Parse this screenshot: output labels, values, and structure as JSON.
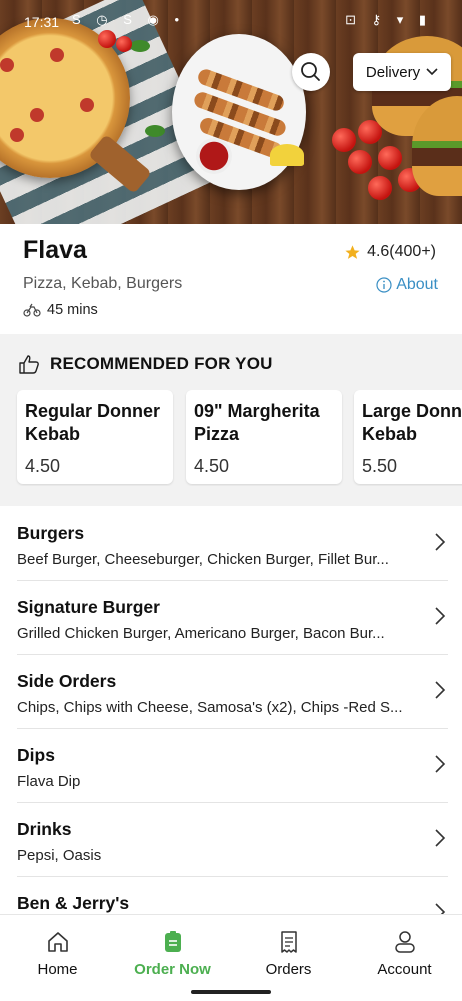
{
  "status_bar": {
    "time": "17:31",
    "left_icons": "S ◷ S ◉ •",
    "right_icons": "⊡ ⚷ ▾ ▮"
  },
  "header": {
    "delivery_label": "Delivery"
  },
  "restaurant": {
    "name": "Flava",
    "cuisines": "Pizza, Kebab, Burgers",
    "eta": "45 mins",
    "rating": "4.6(400+)",
    "about_label": "About"
  },
  "recommended": {
    "title": "RECOMMENDED FOR YOU",
    "items": [
      {
        "name": "Regular Donner\nKebab",
        "price": "4.50"
      },
      {
        "name": "09\" Margherita\nPizza",
        "price": "4.50"
      },
      {
        "name": "Large Donn\nKebab",
        "price": "5.50"
      }
    ]
  },
  "categories": [
    {
      "name": "Burgers",
      "desc": "Beef Burger, Cheeseburger, Chicken Burger, Fillet Bur..."
    },
    {
      "name": "Signature Burger",
      "desc": "Grilled Chicken Burger, Americano Burger, Bacon Bur..."
    },
    {
      "name": "Side Orders",
      "desc": "Chips, Chips with Cheese, Samosa's (x2), Chips -Red S..."
    },
    {
      "name": "Dips",
      "desc": "Flava Dip"
    },
    {
      "name": "Drinks",
      "desc": "Pepsi, Oasis"
    },
    {
      "name": "Ben & Jerry's",
      "desc": ""
    }
  ],
  "nav": {
    "items": [
      {
        "label": "Home",
        "icon": "home-icon",
        "active": false
      },
      {
        "label": "Order Now",
        "icon": "order-icon",
        "active": true
      },
      {
        "label": "Orders",
        "icon": "receipt-icon",
        "active": false
      },
      {
        "label": "Account",
        "icon": "account-icon",
        "active": false
      }
    ]
  },
  "colors": {
    "accent_green": "#4caf50",
    "link_blue": "#3a8fc4",
    "star": "#f2b01e"
  }
}
